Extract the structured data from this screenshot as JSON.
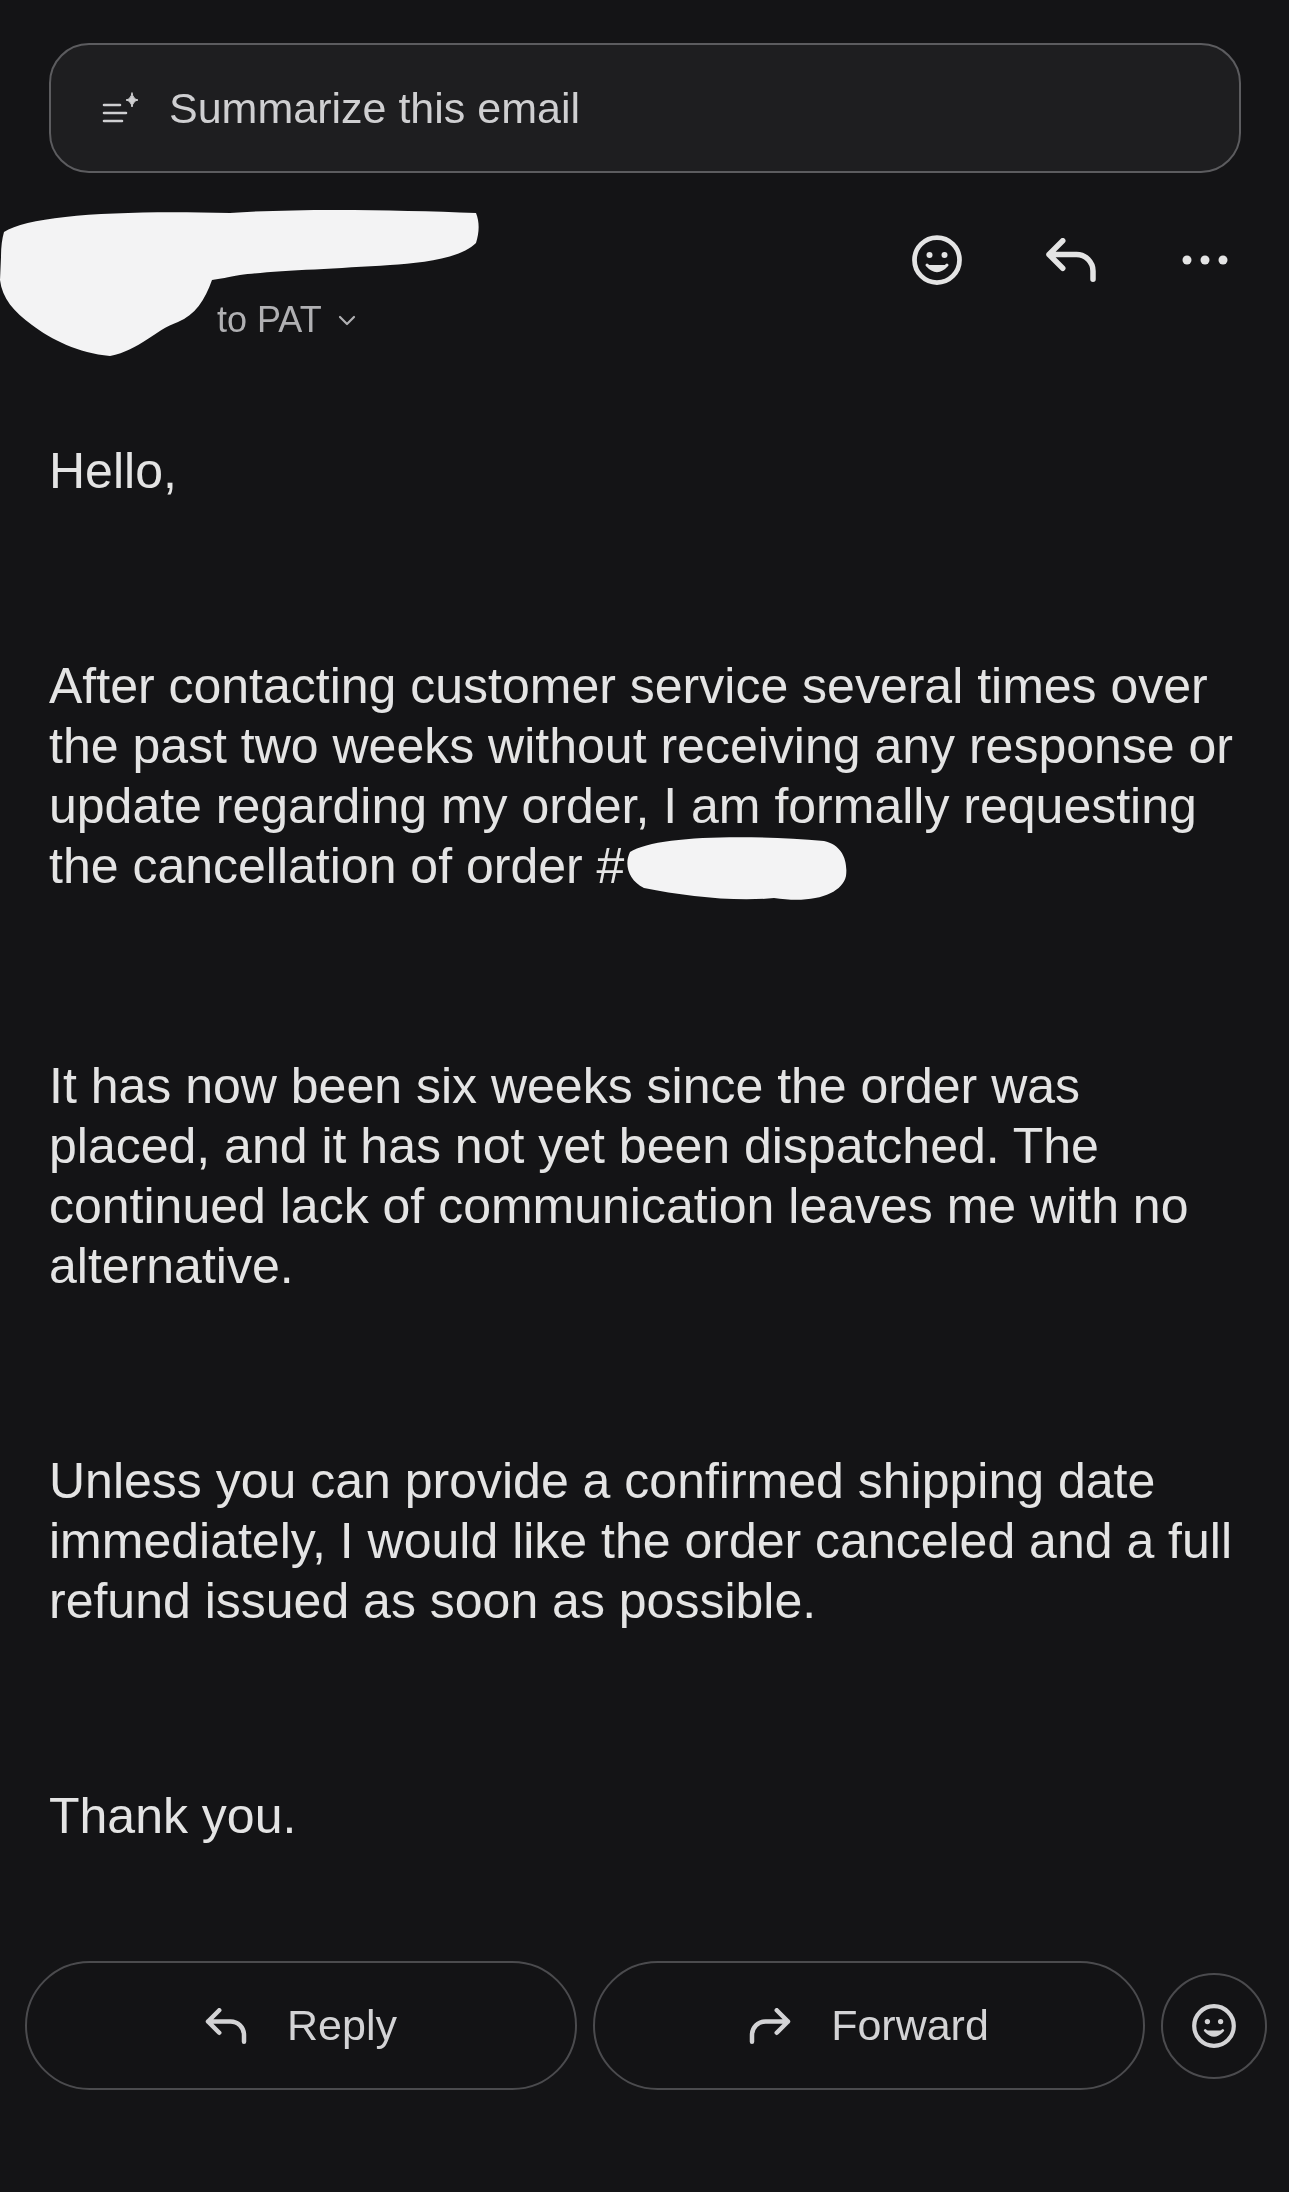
{
  "summarize_button": {
    "label": "Summarize this email"
  },
  "header": {
    "sender_redacted": true,
    "recipient": "to PAT"
  },
  "body": {
    "paragraphs": [
      {
        "lines": [
          "Hello,"
        ],
        "redacted_tail": false
      },
      {
        "lines": [
          "After contacting customer service several times over",
          "the past two weeks without receiving any response or",
          "update regarding my order, I am formally requesting",
          "the cancellation of order #"
        ],
        "redacted_tail": true
      },
      {
        "lines": [
          "It has now been six weeks since the order was",
          "placed, and it has not yet been dispatched. The",
          "continued lack of communication leaves me with no",
          "alternative."
        ],
        "redacted_tail": false
      },
      {
        "lines": [
          "Unless you can provide a confirmed shipping date",
          "immediately, I would like the order canceled and a full",
          "refund issued as soon as possible."
        ],
        "redacted_tail": false
      },
      {
        "lines": [
          "Thank you."
        ],
        "redacted_tail": false
      }
    ]
  },
  "bottom_actions": [
    {
      "kind": "reply",
      "label": "Reply"
    },
    {
      "kind": "forward",
      "label": "Forward"
    },
    {
      "kind": "react"
    }
  ]
}
